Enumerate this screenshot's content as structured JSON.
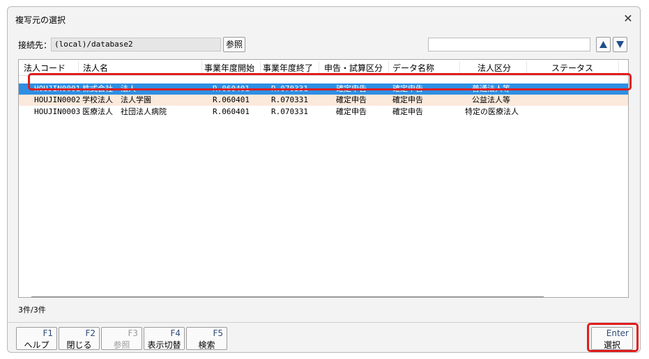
{
  "window": {
    "title": "複写元の選択",
    "close_glyph": "✕"
  },
  "connection": {
    "label": "接続先：",
    "value": "(local)/database2",
    "ref_button": "参照"
  },
  "search": {
    "value": "",
    "placeholder": ""
  },
  "grid": {
    "headers": [
      "法人コード",
      "法人名",
      "事業年度開始",
      "事業年度終了",
      "申告・試算区分",
      "データ名称",
      "法人区分",
      "ステータス"
    ],
    "rows": [
      {
        "code": "HOUJIN0001",
        "name": "株式会社　法人",
        "start": "R.060401",
        "end": "R.070331",
        "kubun": "確定申告",
        "dataname": "確定申告",
        "houjin_kubun": "普通法人等",
        "status": ""
      },
      {
        "code": "HOUJIN0002",
        "name": "学校法人　法人学園",
        "start": "R.060401",
        "end": "R.070331",
        "kubun": "確定申告",
        "dataname": "確定申告",
        "houjin_kubun": "公益法人等",
        "status": ""
      },
      {
        "code": "HOUJIN0003",
        "name": "医療法人　社団法人病院",
        "start": "R.060401",
        "end": "R.070331",
        "kubun": "確定申告",
        "dataname": "確定申告",
        "houjin_kubun": "特定の医療法人",
        "status": ""
      }
    ],
    "selected_row": 0
  },
  "count_text": "3件/3件",
  "fkeys": [
    {
      "key": "F1",
      "label": "ヘルプ",
      "enabled": true
    },
    {
      "key": "F2",
      "label": "閉じる",
      "enabled": true
    },
    {
      "key": "F3",
      "label": "参照",
      "enabled": false
    },
    {
      "key": "F4",
      "label": "表示切替",
      "enabled": true
    },
    {
      "key": "F5",
      "label": "検索",
      "enabled": true
    }
  ],
  "enter_key": {
    "key": "Enter",
    "label": "選択"
  },
  "colors": {
    "selected_row": "#2f8fe3",
    "alt_row": "#fbe9dc",
    "highlight": "#e01d1d"
  }
}
